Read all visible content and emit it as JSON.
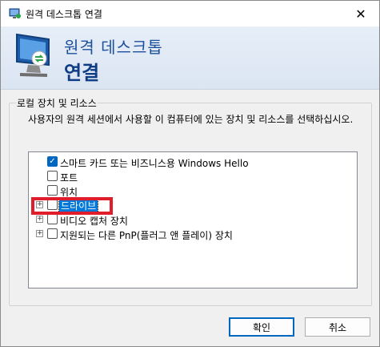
{
  "window": {
    "title": "원격 데스크톱 연결",
    "close_glyph": "✕"
  },
  "banner": {
    "line1": "원격 데스크톱",
    "line2": "연결"
  },
  "group": {
    "title": "로컬 장치 및 리소스",
    "description": "사용자의 원격 세션에서 사용할 이 컴퓨터에 있는 장치 및 리소스를 선택하십시오."
  },
  "tree": {
    "items": [
      {
        "label": "스마트 카드 또는 비즈니스용 Windows Hello",
        "checked": true,
        "expandable": false,
        "selected": false
      },
      {
        "label": "포트",
        "checked": false,
        "expandable": false,
        "selected": false
      },
      {
        "label": "위치",
        "checked": false,
        "expandable": false,
        "selected": false
      },
      {
        "label": "드라이브",
        "checked": false,
        "expandable": true,
        "selected": true
      },
      {
        "label": "비디오 캡처 장치",
        "checked": false,
        "expandable": true,
        "selected": false
      },
      {
        "label": "지원되는 다른 PnP(플러그 앤 플레이) 장치",
        "checked": false,
        "expandable": true,
        "selected": false
      }
    ]
  },
  "buttons": {
    "ok": "확인",
    "cancel": "취소"
  },
  "colors": {
    "accent": "#0067c0",
    "highlight": "#e01e2b",
    "banner_text": "#1c4f9c"
  },
  "icons": {
    "title": "remote-desktop-icon",
    "banner": "monitor-remote-icon",
    "expand": "plus-icon",
    "check": "checkmark-icon"
  }
}
